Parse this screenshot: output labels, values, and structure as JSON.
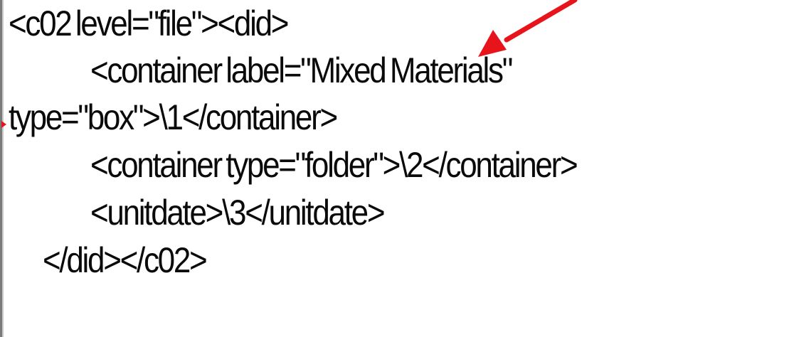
{
  "code": {
    "lines": [
      "<c02 level=\"file\"><did>",
      "<container label=\"Mixed Materials\"",
      "type=\"box\">\\1</container>",
      "<container type=\"folder\">\\2</container>",
      "<unitdate>\\3</unitdate>",
      "</did></c02>"
    ]
  },
  "annotation": {
    "arrow_icon": "red-arrow-icon",
    "arrow_color": "#e8141b"
  },
  "colors": {
    "text": "#0a0a0a",
    "background": "#ffffff",
    "border": "#7a7a7a"
  }
}
